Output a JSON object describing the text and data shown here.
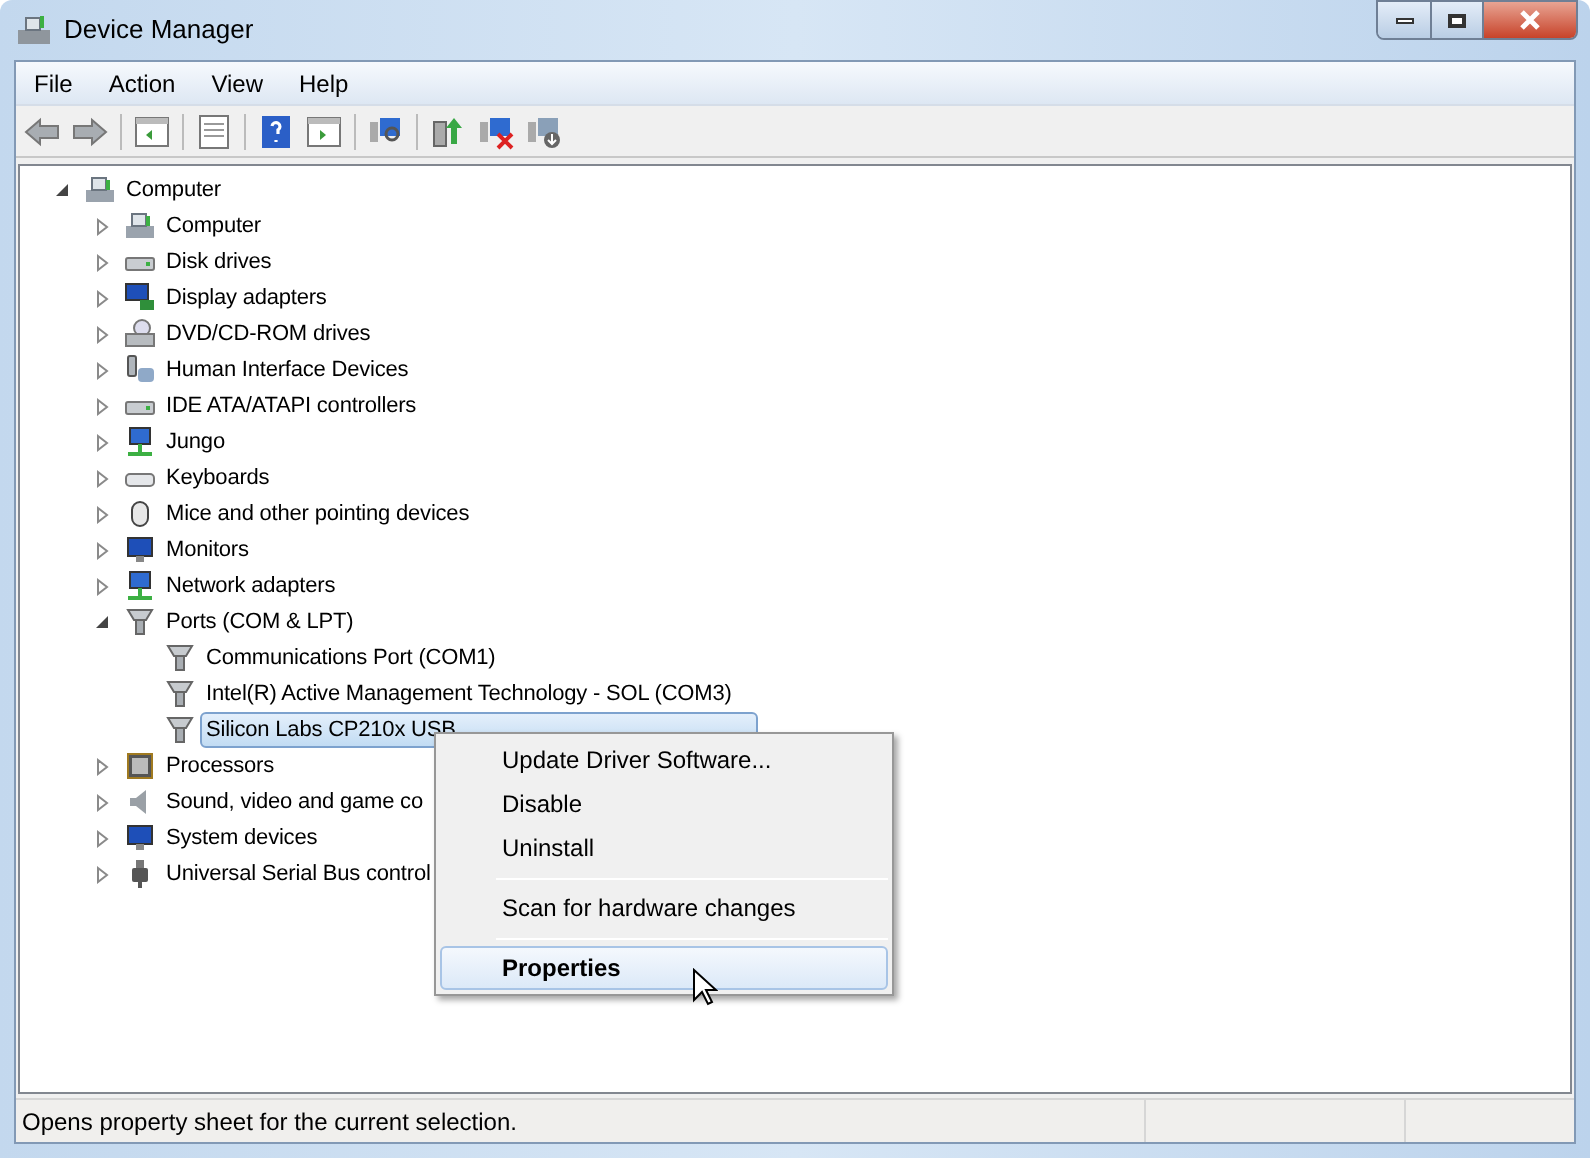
{
  "window": {
    "title": "Device Manager"
  },
  "menu_bar": [
    "File",
    "Action",
    "View",
    "Help"
  ],
  "tree": {
    "label": "Computer",
    "expanded": true,
    "selected": false,
    "children": [
      {
        "label": "Computer",
        "expanded": false,
        "selected": false
      },
      {
        "label": "Disk drives",
        "expanded": false,
        "selected": false
      },
      {
        "label": "Display adapters",
        "expanded": false,
        "selected": false
      },
      {
        "label": "DVD/CD-ROM drives",
        "expanded": false,
        "selected": false
      },
      {
        "label": "Human Interface Devices",
        "expanded": false,
        "selected": false
      },
      {
        "label": "IDE ATA/ATAPI controllers",
        "expanded": false,
        "selected": false
      },
      {
        "label": "Jungo",
        "expanded": false,
        "selected": false
      },
      {
        "label": "Keyboards",
        "expanded": false,
        "selected": false
      },
      {
        "label": "Mice and other pointing devices",
        "expanded": false,
        "selected": false
      },
      {
        "label": "Monitors",
        "expanded": false,
        "selected": false
      },
      {
        "label": "Network adapters",
        "expanded": false,
        "selected": false
      },
      {
        "label": "Ports (COM & LPT)",
        "expanded": true,
        "selected": false,
        "children": [
          {
            "label": "Communications Port (COM1)",
            "selected": false
          },
          {
            "label": "Intel(R) Active Management Technology - SOL (COM3)",
            "selected": false
          },
          {
            "label": "Silicon Labs CP210x USB",
            "selected": true
          }
        ]
      },
      {
        "label": "Processors",
        "expanded": false,
        "selected": false
      },
      {
        "label": "Sound, video and game co",
        "expanded": false,
        "selected": false
      },
      {
        "label": "System devices",
        "expanded": false,
        "selected": false
      },
      {
        "label": "Universal Serial Bus control",
        "expanded": false,
        "selected": false
      }
    ]
  },
  "context_menu": [
    {
      "kind": "item",
      "label": "Update Driver Software...",
      "selected": false,
      "default": false
    },
    {
      "kind": "item",
      "label": "Disable",
      "selected": false,
      "default": false
    },
    {
      "kind": "item",
      "label": "Uninstall",
      "selected": false,
      "default": false
    },
    {
      "kind": "separator"
    },
    {
      "kind": "item",
      "label": "Scan for hardware changes",
      "selected": false,
      "default": false
    },
    {
      "kind": "separator"
    },
    {
      "kind": "item",
      "label": "Properties",
      "selected": true,
      "default": true
    }
  ],
  "status_bar": {
    "text": "Opens property sheet for the current selection."
  }
}
